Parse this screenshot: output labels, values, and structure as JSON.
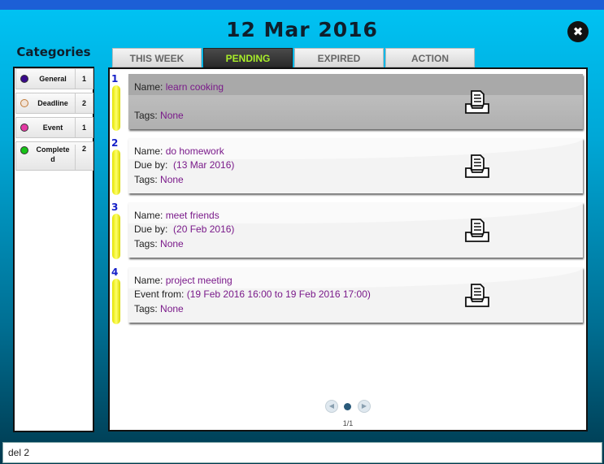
{
  "header": {
    "date": "12 Mar 2016",
    "close_icon": "close-icon"
  },
  "categories": {
    "title": "Categories",
    "items": [
      {
        "label": "General",
        "count": "1",
        "color": "#3a0a8a"
      },
      {
        "label": "Deadline",
        "count": "2",
        "color": "#f2e3d6"
      },
      {
        "label": "Event",
        "count": "1",
        "color": "#e43aa4"
      },
      {
        "label": "Complete d",
        "count": "2",
        "color": "#18c318"
      }
    ]
  },
  "tabs": [
    {
      "label": "THIS WEEK",
      "active": false
    },
    {
      "label": "PENDING",
      "active": true
    },
    {
      "label": "EXPIRED",
      "active": false
    },
    {
      "label": "ACTION",
      "active": false
    }
  ],
  "tasks": [
    {
      "num": "1",
      "name_label": "Name:",
      "name": "learn cooking",
      "tags_label": "Tags:",
      "tags": "None",
      "icon": "inbox-document-icon",
      "selected": true
    },
    {
      "num": "2",
      "name_label": "Name:",
      "name": "do homework",
      "due_label": "Due by:",
      "due": "(13 Mar 2016)",
      "tags_label": "Tags:",
      "tags": "None",
      "icon": "inbox-document-icon"
    },
    {
      "num": "3",
      "name_label": "Name:",
      "name": "meet friends",
      "due_label": "Due by:",
      "due": "(20 Feb 2016)",
      "tags_label": "Tags:",
      "tags": "None",
      "icon": "inbox-document-icon"
    },
    {
      "num": "4",
      "name_label": "Name:",
      "name": "project meeting",
      "event_label": "Event from:",
      "event": "(19 Feb 2016 16:00 to 19 Feb 2016 17:00)",
      "tags_label": "Tags:",
      "tags": "None",
      "icon": "inbox-document-icon"
    }
  ],
  "pager": {
    "page_count": "1/1",
    "prev_icon": "prev-arrow-icon",
    "next_icon": "next-arrow-icon"
  },
  "command": {
    "value": "del 2"
  },
  "colors": {
    "accent_tab": "#a8ee2a",
    "value_text": "#7a1a8a",
    "task_number": "#1520c8"
  }
}
